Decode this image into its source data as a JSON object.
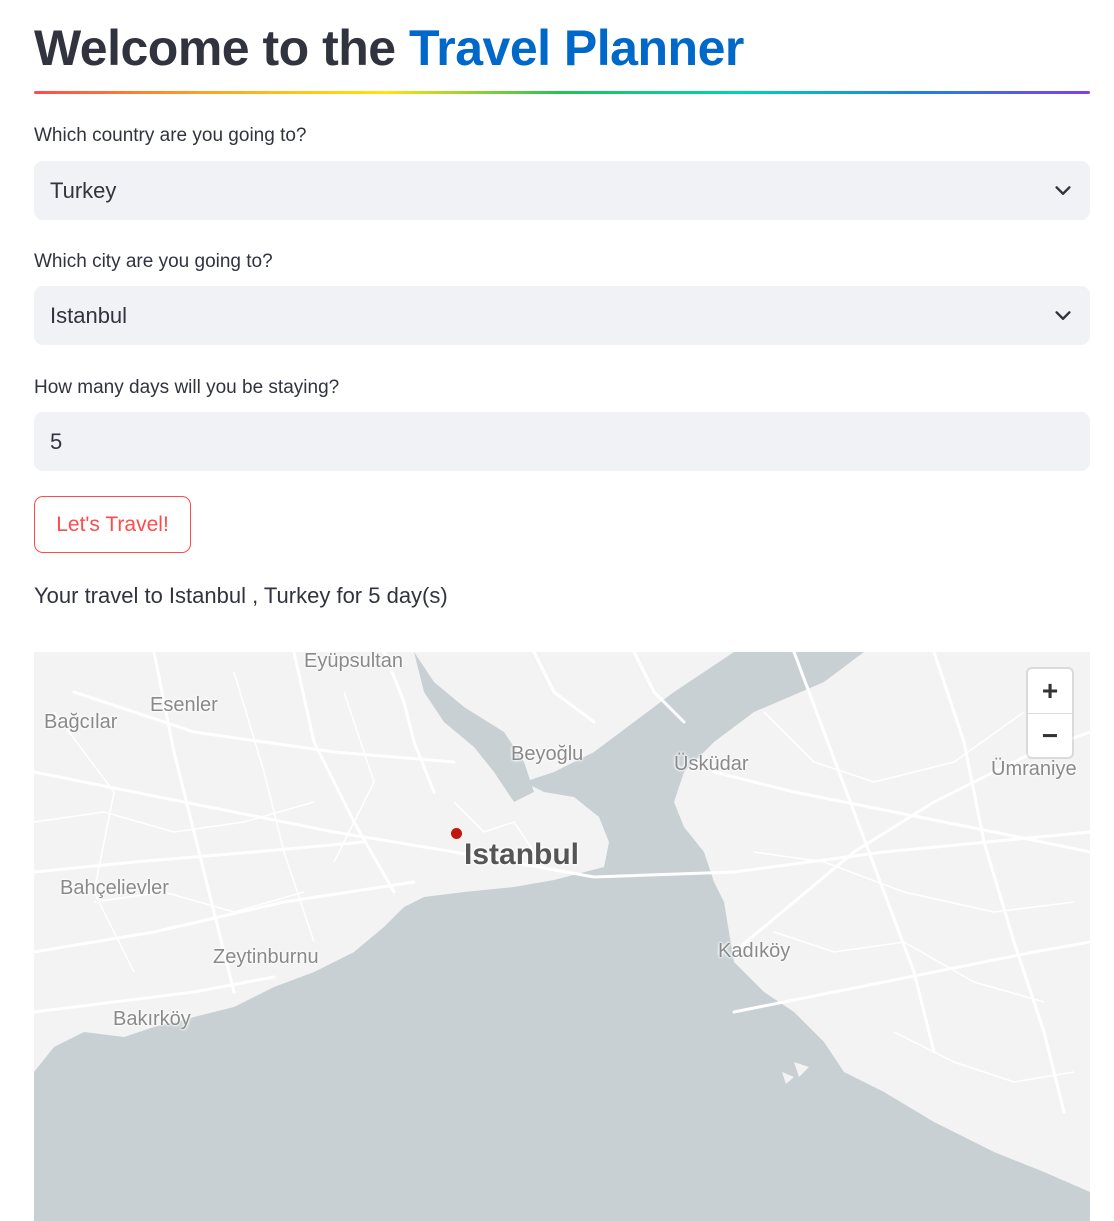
{
  "header": {
    "title_prefix": "Welcome to the ",
    "title_accent": "Travel Planner"
  },
  "form": {
    "country": {
      "label": "Which country are you going to?",
      "value": "Turkey"
    },
    "city": {
      "label": "Which city are you going to?",
      "value": "Istanbul"
    },
    "days": {
      "label": "How many days will you be staying?",
      "value": "5"
    },
    "submit_label": "Let's Travel!"
  },
  "result": {
    "summary": "Your travel to Istanbul , Turkey for 5 day(s)"
  },
  "map": {
    "labels": {
      "eyupsultan": "Eyüpsultan",
      "esenler": "Esenler",
      "bagcilar": "Bağcılar",
      "beyoglu": "Beyoğlu",
      "uskudar": "Üsküdar",
      "umraniye": "Ümraniye",
      "istanbul": "Istanbul",
      "bahcelievler": "Bahçelievler",
      "zeytinburnu": "Zeytinburnu",
      "kadikoy": "Kadıköy",
      "bakirkoy": "Bakırköy"
    },
    "zoom_in": "+",
    "zoom_out": "−",
    "marker_color": "#c0180c",
    "water_color": "#c8d0d3",
    "land_color": "#f3f3f3"
  },
  "icons": {
    "country_select": "chevron-down-icon",
    "city_select": "chevron-down-icon"
  }
}
